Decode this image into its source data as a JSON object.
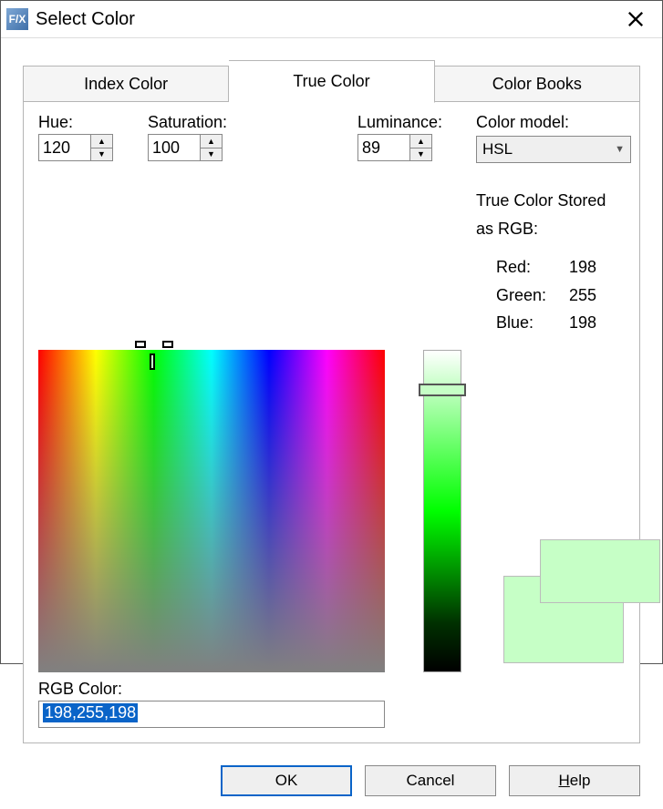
{
  "window": {
    "title": "Select Color",
    "app_icon_text": "F/X"
  },
  "tabs": {
    "index": "Index Color",
    "true": "True Color",
    "books": "Color Books",
    "active": "true"
  },
  "hsl": {
    "hue_label": "Hue:",
    "sat_label": "Saturation:",
    "lum_label": "Luminance:",
    "hue": "120",
    "sat": "100",
    "lum": "89"
  },
  "color_model": {
    "label": "Color model:",
    "value": "HSL"
  },
  "stored": {
    "heading1": "True Color Stored",
    "heading2": "as RGB:",
    "red_label": "Red:",
    "green_label": "Green:",
    "blue_label": "Blue:",
    "red": "198",
    "green": "255",
    "blue": "198"
  },
  "rgb_field": {
    "label": "RGB Color:",
    "value": "198,255,198"
  },
  "preview": {
    "current": "#c6ffc6",
    "previous": "#c6ffc6"
  },
  "buttons": {
    "ok": "OK",
    "cancel": "Cancel",
    "help": "Help"
  }
}
